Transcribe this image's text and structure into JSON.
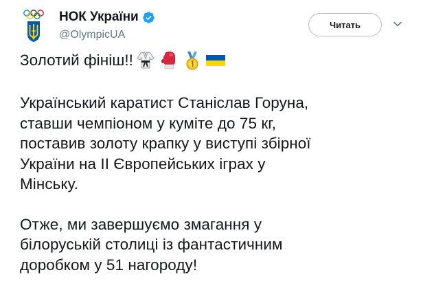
{
  "author": {
    "display_name": "НОК України",
    "handle": "@OlympicUA",
    "verified": true
  },
  "follow_button": {
    "label": "Читать"
  },
  "menu": {
    "icon": "chevron-down-icon"
  },
  "tweet": {
    "line1": "Золотий фініш!!",
    "emojis": [
      "martial-arts-uniform-emoji",
      "boxing-glove-emoji",
      "gold-medal-emoji",
      "ukraine-flag-emoji"
    ],
    "para2": "Український каратист Станіслав Горуна,\nставши чемпіоном у куміте до 75 кг,\nпоставив золоту крапку у виступі збірної\nУкраїни на ІІ Європейських іграх у\nМінську.",
    "para3": "Отже, ми завершуємо змагання у\nбілоруській столиці із фантастичним\nдоробком у 51 нагороду!"
  },
  "colors": {
    "text": "#14171a",
    "secondary": "#657786",
    "verified": "#1da1f2",
    "flag_blue": "#0057b7",
    "flag_yellow": "#ffd700"
  }
}
